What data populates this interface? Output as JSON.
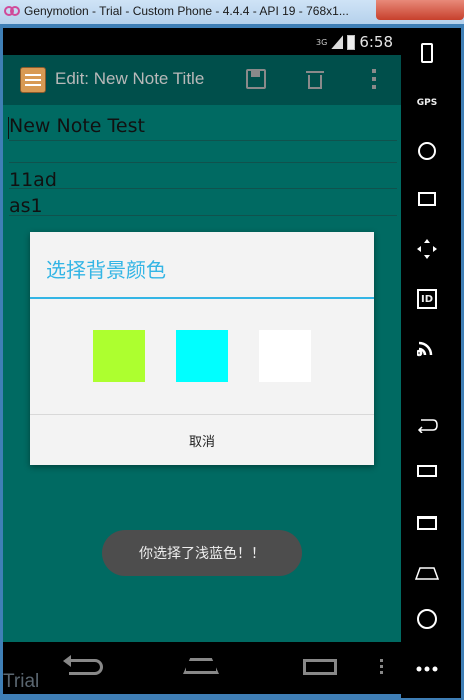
{
  "window": {
    "title": "Genymotion - Trial - Custom Phone - 4.4.4 - API 19 - 768x1..."
  },
  "status_bar": {
    "network": "3G",
    "time": "6:58"
  },
  "action_bar": {
    "title": "Edit: New Note Title",
    "save_icon": "save-icon",
    "delete_icon": "delete-icon",
    "overflow_icon": "overflow-menu-icon"
  },
  "note": {
    "title": "New Note Test",
    "line1": "11ad",
    "line2": "as1"
  },
  "dialog": {
    "title": "选择背景颜色",
    "swatches": [
      {
        "color": "#adff2f"
      },
      {
        "color": "#00ffff"
      },
      {
        "color": "#ffffff"
      }
    ],
    "cancel_label": "取消"
  },
  "toast": {
    "text": "你选择了浅蓝色！！"
  },
  "watermark": "Trial",
  "side_panel": {
    "items": [
      "battery-icon",
      "gps-icon",
      "camera-icon",
      "capture-icon",
      "dpad-icon",
      "id-icon",
      "cast-icon",
      "back-icon",
      "recent-apps-icon",
      "menu-icon",
      "home-icon",
      "power-icon",
      "more-icon"
    ],
    "gps_label": "GPS",
    "id_label": "ID"
  },
  "colors": {
    "content_bg": "#006a62",
    "action_bar_bg": "#004f4b",
    "accent": "#33b5e5"
  }
}
